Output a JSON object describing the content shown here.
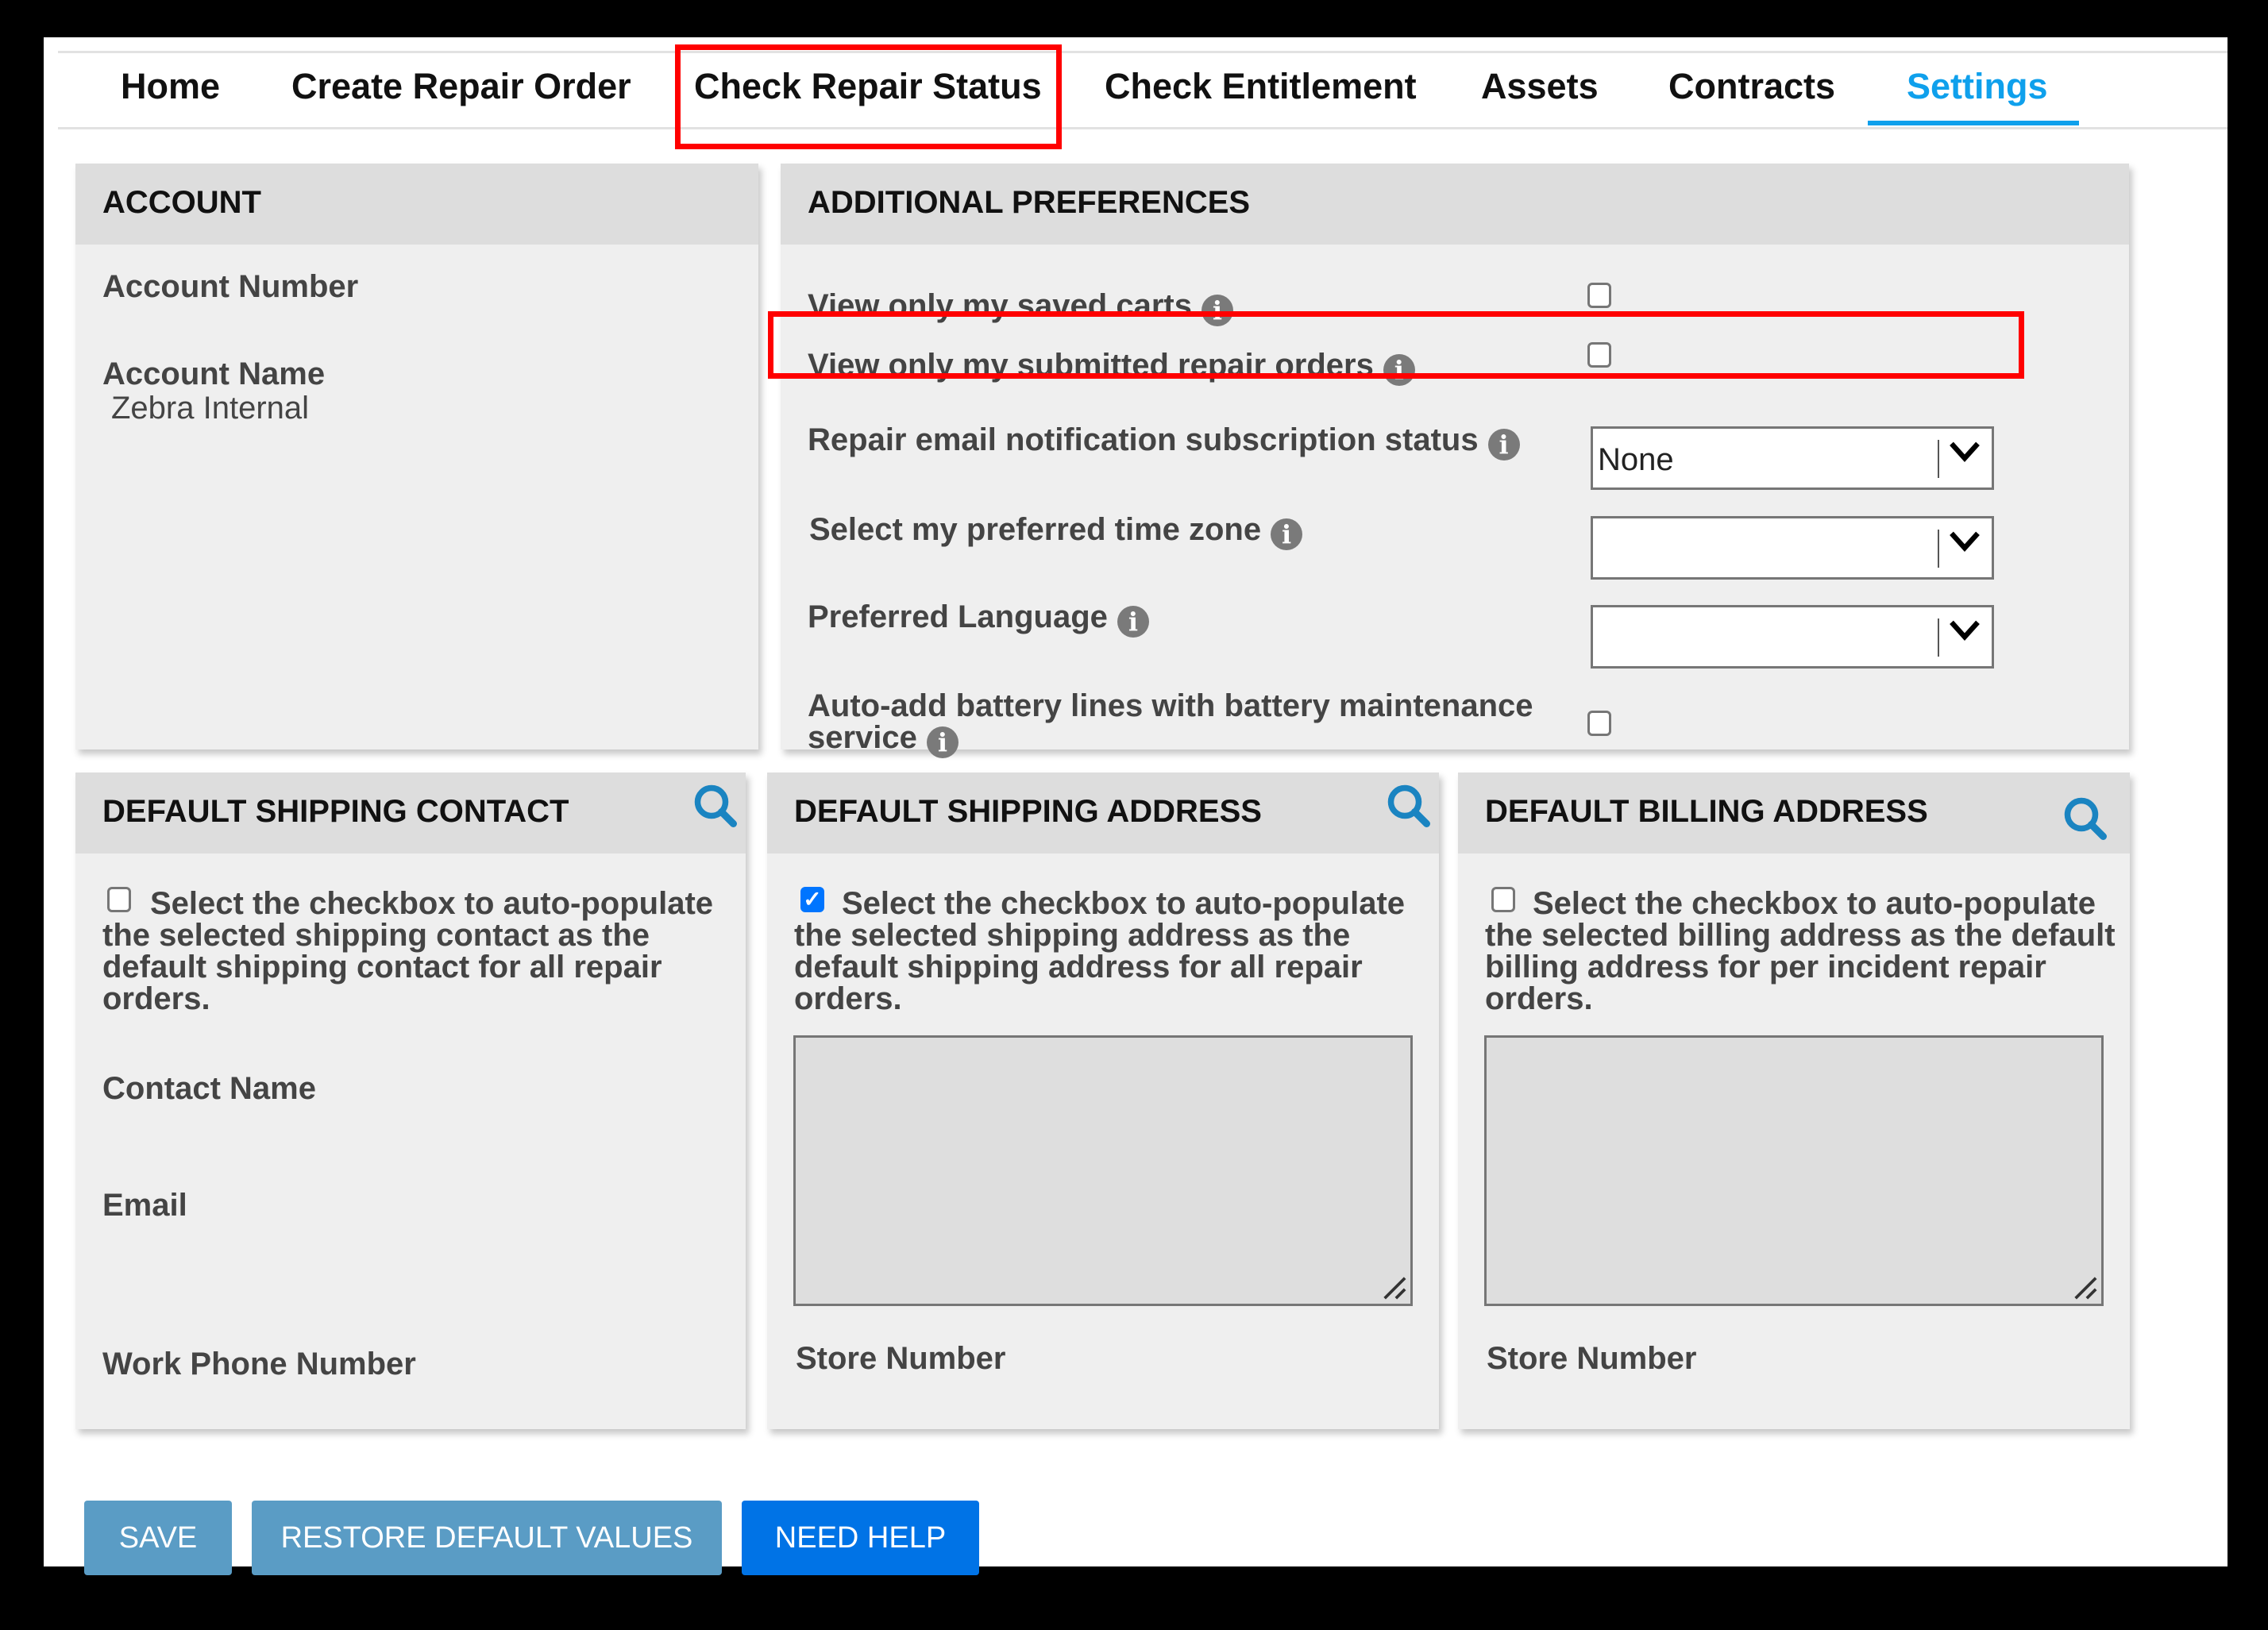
{
  "nav": {
    "tabs": [
      {
        "label": "Home",
        "active": false
      },
      {
        "label": "Create Repair Order",
        "active": false
      },
      {
        "label": "Check Repair Status",
        "active": false,
        "highlighted": true
      },
      {
        "label": "Check Entitlement",
        "active": false
      },
      {
        "label": "Assets",
        "active": false
      },
      {
        "label": "Contracts",
        "active": false
      },
      {
        "label": "Settings",
        "active": true
      }
    ],
    "active_color": "#0fa0ec"
  },
  "account": {
    "title": "ACCOUNT",
    "account_number_label": "Account Number",
    "account_number_value": "",
    "account_name_label": "Account Name",
    "account_name_value": "Zebra Internal"
  },
  "preferences": {
    "title": "ADDITIONAL PREFERENCES",
    "saved_carts": {
      "label": "View only my saved carts",
      "info_icon": "info-icon",
      "checked": false
    },
    "submitted_orders": {
      "label": "View only my submitted repair orders",
      "info_icon": "info-icon",
      "checked": false,
      "highlighted": true
    },
    "email_notification": {
      "label": "Repair email notification subscription status",
      "info_icon": "info-icon",
      "value": "None"
    },
    "time_zone": {
      "label": "Select my preferred time zone",
      "info_icon": "info-icon",
      "value": ""
    },
    "language": {
      "label": "Preferred Language",
      "info_icon": "info-icon",
      "value": ""
    },
    "battery": {
      "label_line1": "Auto-add battery lines with battery maintenance",
      "label_line2": "service",
      "info_icon": "info-icon",
      "checked": false
    }
  },
  "shipping_contact": {
    "title": "DEFAULT SHIPPING CONTACT",
    "search_icon": "search-icon",
    "checked": false,
    "description": "Select the checkbox to auto-populate the selected shipping contact as the default shipping contact for all repair orders.",
    "contact_name_label": "Contact Name",
    "email_label": "Email",
    "work_phone_label": "Work Phone Number"
  },
  "shipping_address": {
    "title": "DEFAULT SHIPPING ADDRESS",
    "search_icon": "search-icon",
    "checked": true,
    "description": "Select the checkbox to auto-populate the selected shipping address as the default shipping address for all repair orders.",
    "address_value": "",
    "store_number_label": "Store Number"
  },
  "billing_address": {
    "title": "DEFAULT BILLING ADDRESS",
    "search_icon": "search-icon",
    "checked": false,
    "description": "Select the checkbox to auto-populate the selected billing address as the default billing address for per incident repair orders.",
    "address_value": "",
    "store_number_label": "Store Number"
  },
  "actions": {
    "save_label": "SAVE",
    "restore_label": "RESTORE DEFAULT VALUES",
    "help_label": "NEED HELP",
    "secondary_color": "#5a9cc5",
    "primary_color": "#0073e6"
  },
  "annotation_color": "#ff0000"
}
